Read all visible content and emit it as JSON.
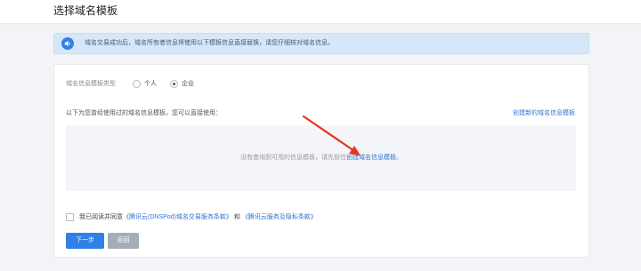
{
  "header": {
    "title": "选择域名模板"
  },
  "notice": {
    "icon": "speaker-icon",
    "text": "域名交易成功后，域名所有者信息将使用以下模板信息直接替换，请您仔细核对域名信息。"
  },
  "template_type": {
    "label": "域名信息模板类型",
    "options": [
      {
        "label": "个人",
        "selected": false
      },
      {
        "label": "企业",
        "selected": true
      }
    ]
  },
  "templates": {
    "title": "以下为您曾经使用过的域名信息模板，您可以直接使用：",
    "create_link": "创建新的域名信息模板",
    "empty_text": "没有查询到可用的信息模板，请先前往",
    "empty_link": "创建域名信息模板",
    "empty_suffix": "。"
  },
  "agreement": {
    "prefix": "我已阅读并同意",
    "link1": "《腾讯云(DNSPod)域名交易服务条款》",
    "and": "和",
    "link2": "《腾讯云服务及隐私条款》",
    "checked": false
  },
  "buttons": {
    "next": "下一步",
    "back": "返回"
  },
  "colors": {
    "accent": "#2f80e7",
    "link": "#2e73d3",
    "notice_bg": "#d6e7f9",
    "annotation_arrow": "#e8331f"
  }
}
